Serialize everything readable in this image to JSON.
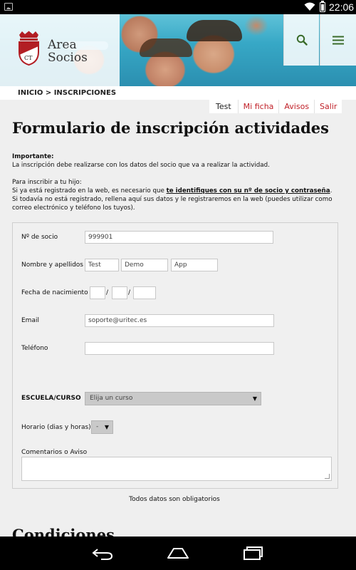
{
  "status_bar": {
    "time": "22:06"
  },
  "header": {
    "logo_text_line1": "Area",
    "logo_text_line2": "Socios",
    "crest_letters": "CT"
  },
  "breadcrumb": "INICIO > INSCRIPCIONES",
  "tabs": [
    "Test",
    "Mi ficha",
    "Avisos",
    "Salir"
  ],
  "title": "Formulario de inscripción actividades",
  "info": {
    "important_label": "Importante:",
    "important_text": "La inscripción debe realizarse con los datos del socio que va a realizar la actividad.",
    "child_intro": "Para inscribir a tu hijo:",
    "registered_text": "Si ya está registrado en la web, es necesario que ",
    "registered_link": "te identifiques con su nº de socio y contraseña",
    "registered_end": ".",
    "not_registered_text": "Si todavía no está registrado, rellena aquí sus datos y le registraremos en la web (puedes utilizar como correo electrónico y teléfono los tuyos)."
  },
  "form": {
    "socio_label": "Nº de socio",
    "socio_value": "999901",
    "nombre_label": "Nombre y apellidos",
    "nombre_value": "Test",
    "apellido1_value": "Demo",
    "apellido2_value": "App",
    "fecha_label": "Fecha de nacimiento",
    "fecha_day": "",
    "fecha_month": "",
    "fecha_year": "",
    "fecha_sep": "/",
    "email_label": "Email",
    "email_value": "soporte@uritec.es",
    "telefono_label": "Teléfono",
    "telefono_value": "",
    "escuela_label": "ESCUELA/CURSO",
    "escuela_selected": "Elija un curso",
    "horario_label": "Horario (dias y horas)",
    "horario_selected": "-",
    "comentarios_label": "Comentarios o Aviso",
    "comentarios_value": ""
  },
  "note": "Todos datos son obligatorios",
  "conditions_heading": "Condiciones",
  "colors": {
    "accent_red": "#c02028",
    "header_button_green": "#3a6b2a",
    "background": "#efefef"
  }
}
